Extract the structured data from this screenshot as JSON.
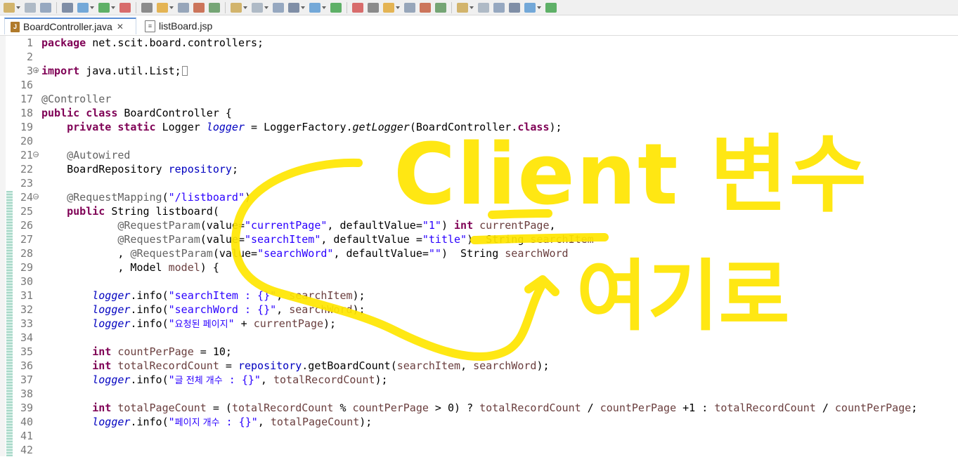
{
  "tabs": [
    {
      "label": "BoardController.java",
      "active": true,
      "icon": "java-file-icon"
    },
    {
      "label": "listBoard.jsp",
      "active": false,
      "icon": "jsp-file-icon"
    }
  ],
  "toolbar_icons": [
    "new-dropdown-icon",
    "save-icon",
    "save-all-icon",
    "print-icon",
    "breakpoint-icon",
    "run-last-icon",
    "refresh-icon",
    "pin-icon",
    "highlight-icon",
    "show-whitespace-icon",
    "block-selection-icon",
    "pilcrow-icon",
    "debug-icon",
    "run-icon",
    "coverage-icon",
    "stop-icon",
    "external-tools-icon",
    "new-java-project-icon",
    "new-package-icon",
    "new-class-icon",
    "open-type-icon",
    "open-task-icon",
    "search-icon",
    "open-folder-icon",
    "next-annotation-icon",
    "prev-annotation-icon",
    "last-edit-icon",
    "back-icon",
    "forward-icon",
    "maximize-icon"
  ],
  "lines": [
    {
      "n": "1",
      "tokens": [
        {
          "t": "package",
          "c": "kw"
        },
        {
          "t": " net.scit.board.controllers;"
        }
      ]
    },
    {
      "n": "2",
      "tokens": []
    },
    {
      "n": "3",
      "fold": "+",
      "tokens": [
        {
          "t": "import",
          "c": "kw"
        },
        {
          "t": " java.util.List;"
        },
        {
          "t": "",
          "c": "box"
        }
      ]
    },
    {
      "n": "16",
      "tokens": []
    },
    {
      "n": "17",
      "tokens": [
        {
          "t": "@Controller",
          "c": "ann"
        }
      ]
    },
    {
      "n": "18",
      "tokens": [
        {
          "t": "public",
          "c": "kw"
        },
        {
          "t": " "
        },
        {
          "t": "class",
          "c": "kw"
        },
        {
          "t": " BoardController {"
        }
      ]
    },
    {
      "n": "19",
      "tokens": [
        {
          "t": "    "
        },
        {
          "t": "private",
          "c": "kw"
        },
        {
          "t": " "
        },
        {
          "t": "static",
          "c": "kw"
        },
        {
          "t": " Logger "
        },
        {
          "t": "logger",
          "c": "sfld"
        },
        {
          "t": " = LoggerFactory."
        },
        {
          "t": "getLogger",
          "c": "smeth"
        },
        {
          "t": "(BoardController."
        },
        {
          "t": "class",
          "c": "kw"
        },
        {
          "t": ");"
        }
      ]
    },
    {
      "n": "20",
      "tokens": []
    },
    {
      "n": "21",
      "fold": "-",
      "tokens": [
        {
          "t": "    "
        },
        {
          "t": "@Autowired",
          "c": "ann"
        }
      ]
    },
    {
      "n": "22",
      "tokens": [
        {
          "t": "    BoardRepository "
        },
        {
          "t": "repository",
          "c": "fld"
        },
        {
          "t": ";"
        }
      ]
    },
    {
      "n": "23",
      "tokens": []
    },
    {
      "n": "24",
      "fold": "-",
      "tokens": [
        {
          "t": "    "
        },
        {
          "t": "@RequestMapping",
          "c": "ann"
        },
        {
          "t": "("
        },
        {
          "t": "\"/listboard\"",
          "c": "str"
        },
        {
          "t": ")"
        }
      ]
    },
    {
      "n": "25",
      "tokens": [
        {
          "t": "    "
        },
        {
          "t": "public",
          "c": "kw"
        },
        {
          "t": " String listboard("
        }
      ]
    },
    {
      "n": "26",
      "tokens": [
        {
          "t": "            "
        },
        {
          "t": "@RequestParam",
          "c": "ann"
        },
        {
          "t": "(value="
        },
        {
          "t": "\"currentPage\"",
          "c": "str"
        },
        {
          "t": ", defaultValue="
        },
        {
          "t": "\"1\"",
          "c": "str"
        },
        {
          "t": ") "
        },
        {
          "t": "int",
          "c": "kw"
        },
        {
          "t": " "
        },
        {
          "t": "currentPage",
          "c": "var"
        },
        {
          "t": ","
        }
      ]
    },
    {
      "n": "27",
      "tokens": [
        {
          "t": "            "
        },
        {
          "t": "@RequestParam",
          "c": "ann"
        },
        {
          "t": "(value="
        },
        {
          "t": "\"searchItem\"",
          "c": "str"
        },
        {
          "t": ", defaultValue ="
        },
        {
          "t": "\"title\"",
          "c": "str"
        },
        {
          "t": ")  String "
        },
        {
          "t": "searchItem",
          "c": "var"
        }
      ]
    },
    {
      "n": "28",
      "tokens": [
        {
          "t": "            , "
        },
        {
          "t": "@RequestParam",
          "c": "ann"
        },
        {
          "t": "(value="
        },
        {
          "t": "\"searchWord\"",
          "c": "str"
        },
        {
          "t": ", defaultValue="
        },
        {
          "t": "\"\"",
          "c": "str"
        },
        {
          "t": ")  String "
        },
        {
          "t": "searchWord",
          "c": "var"
        }
      ]
    },
    {
      "n": "29",
      "tokens": [
        {
          "t": "            , Model "
        },
        {
          "t": "model",
          "c": "var"
        },
        {
          "t": ") {"
        }
      ]
    },
    {
      "n": "30",
      "tokens": []
    },
    {
      "n": "31",
      "tokens": [
        {
          "t": "        "
        },
        {
          "t": "logger",
          "c": "sfld"
        },
        {
          "t": ".info("
        },
        {
          "t": "\"searchItem : {}\"",
          "c": "str"
        },
        {
          "t": ", "
        },
        {
          "t": "searchItem",
          "c": "var"
        },
        {
          "t": ");"
        }
      ]
    },
    {
      "n": "32",
      "tokens": [
        {
          "t": "        "
        },
        {
          "t": "logger",
          "c": "sfld"
        },
        {
          "t": ".info("
        },
        {
          "t": "\"searchWord : {}\"",
          "c": "str"
        },
        {
          "t": ", "
        },
        {
          "t": "searchWord",
          "c": "var"
        },
        {
          "t": ");"
        }
      ]
    },
    {
      "n": "33",
      "tokens": [
        {
          "t": "        "
        },
        {
          "t": "logger",
          "c": "sfld"
        },
        {
          "t": ".info("
        },
        {
          "t": "\"",
          "c": "str"
        },
        {
          "t": "요청된 페이지",
          "c": "strkr"
        },
        {
          "t": "\"",
          "c": "str"
        },
        {
          "t": " + "
        },
        {
          "t": "currentPage",
          "c": "var"
        },
        {
          "t": ");"
        }
      ]
    },
    {
      "n": "34",
      "tokens": []
    },
    {
      "n": "35",
      "tokens": [
        {
          "t": "        "
        },
        {
          "t": "int",
          "c": "kw"
        },
        {
          "t": " "
        },
        {
          "t": "countPerPage",
          "c": "var"
        },
        {
          "t": " = 10;"
        }
      ]
    },
    {
      "n": "36",
      "tokens": [
        {
          "t": "        "
        },
        {
          "t": "int",
          "c": "kw"
        },
        {
          "t": " "
        },
        {
          "t": "totalRecordCount",
          "c": "var"
        },
        {
          "t": " = "
        },
        {
          "t": "repository",
          "c": "fld"
        },
        {
          "t": ".getBoardCount("
        },
        {
          "t": "searchItem",
          "c": "var"
        },
        {
          "t": ", "
        },
        {
          "t": "searchWord",
          "c": "var"
        },
        {
          "t": ");"
        }
      ]
    },
    {
      "n": "37",
      "tokens": [
        {
          "t": "        "
        },
        {
          "t": "logger",
          "c": "sfld"
        },
        {
          "t": ".info("
        },
        {
          "t": "\"",
          "c": "str"
        },
        {
          "t": "글 전체 개수",
          "c": "strkr"
        },
        {
          "t": " : {}\"",
          "c": "str"
        },
        {
          "t": ", "
        },
        {
          "t": "totalRecordCount",
          "c": "var"
        },
        {
          "t": ");"
        }
      ]
    },
    {
      "n": "38",
      "tokens": []
    },
    {
      "n": "39",
      "tokens": [
        {
          "t": "        "
        },
        {
          "t": "int",
          "c": "kw"
        },
        {
          "t": " "
        },
        {
          "t": "totalPageCount",
          "c": "var"
        },
        {
          "t": " = ("
        },
        {
          "t": "totalRecordCount",
          "c": "var"
        },
        {
          "t": " % "
        },
        {
          "t": "countPerPage",
          "c": "var"
        },
        {
          "t": " > 0) ? "
        },
        {
          "t": "totalRecordCount",
          "c": "var"
        },
        {
          "t": " / "
        },
        {
          "t": "countPerPage",
          "c": "var"
        },
        {
          "t": " +1 : "
        },
        {
          "t": "totalRecordCount",
          "c": "var"
        },
        {
          "t": " / "
        },
        {
          "t": "countPerPage",
          "c": "var"
        },
        {
          "t": ";"
        }
      ]
    },
    {
      "n": "40",
      "tokens": [
        {
          "t": "        "
        },
        {
          "t": "logger",
          "c": "sfld"
        },
        {
          "t": ".info("
        },
        {
          "t": "\"",
          "c": "str"
        },
        {
          "t": "페이지 개수",
          "c": "strkr"
        },
        {
          "t": " : {}\"",
          "c": "str"
        },
        {
          "t": ", "
        },
        {
          "t": "totalPageCount",
          "c": "var"
        },
        {
          "t": ");"
        }
      ]
    },
    {
      "n": "41",
      "tokens": []
    },
    {
      "n": "42",
      "tokens": []
    }
  ],
  "handwriting": {
    "line1": "Client 변수",
    "line2": "여기로",
    "color": "#ffe600"
  },
  "colors": {
    "keyword": "#7f0055",
    "string": "#2a00ff",
    "annotation": "#646464",
    "field": "#0000c0",
    "local": "#6a3e3e",
    "tab_accent": "#5b8fd6"
  }
}
